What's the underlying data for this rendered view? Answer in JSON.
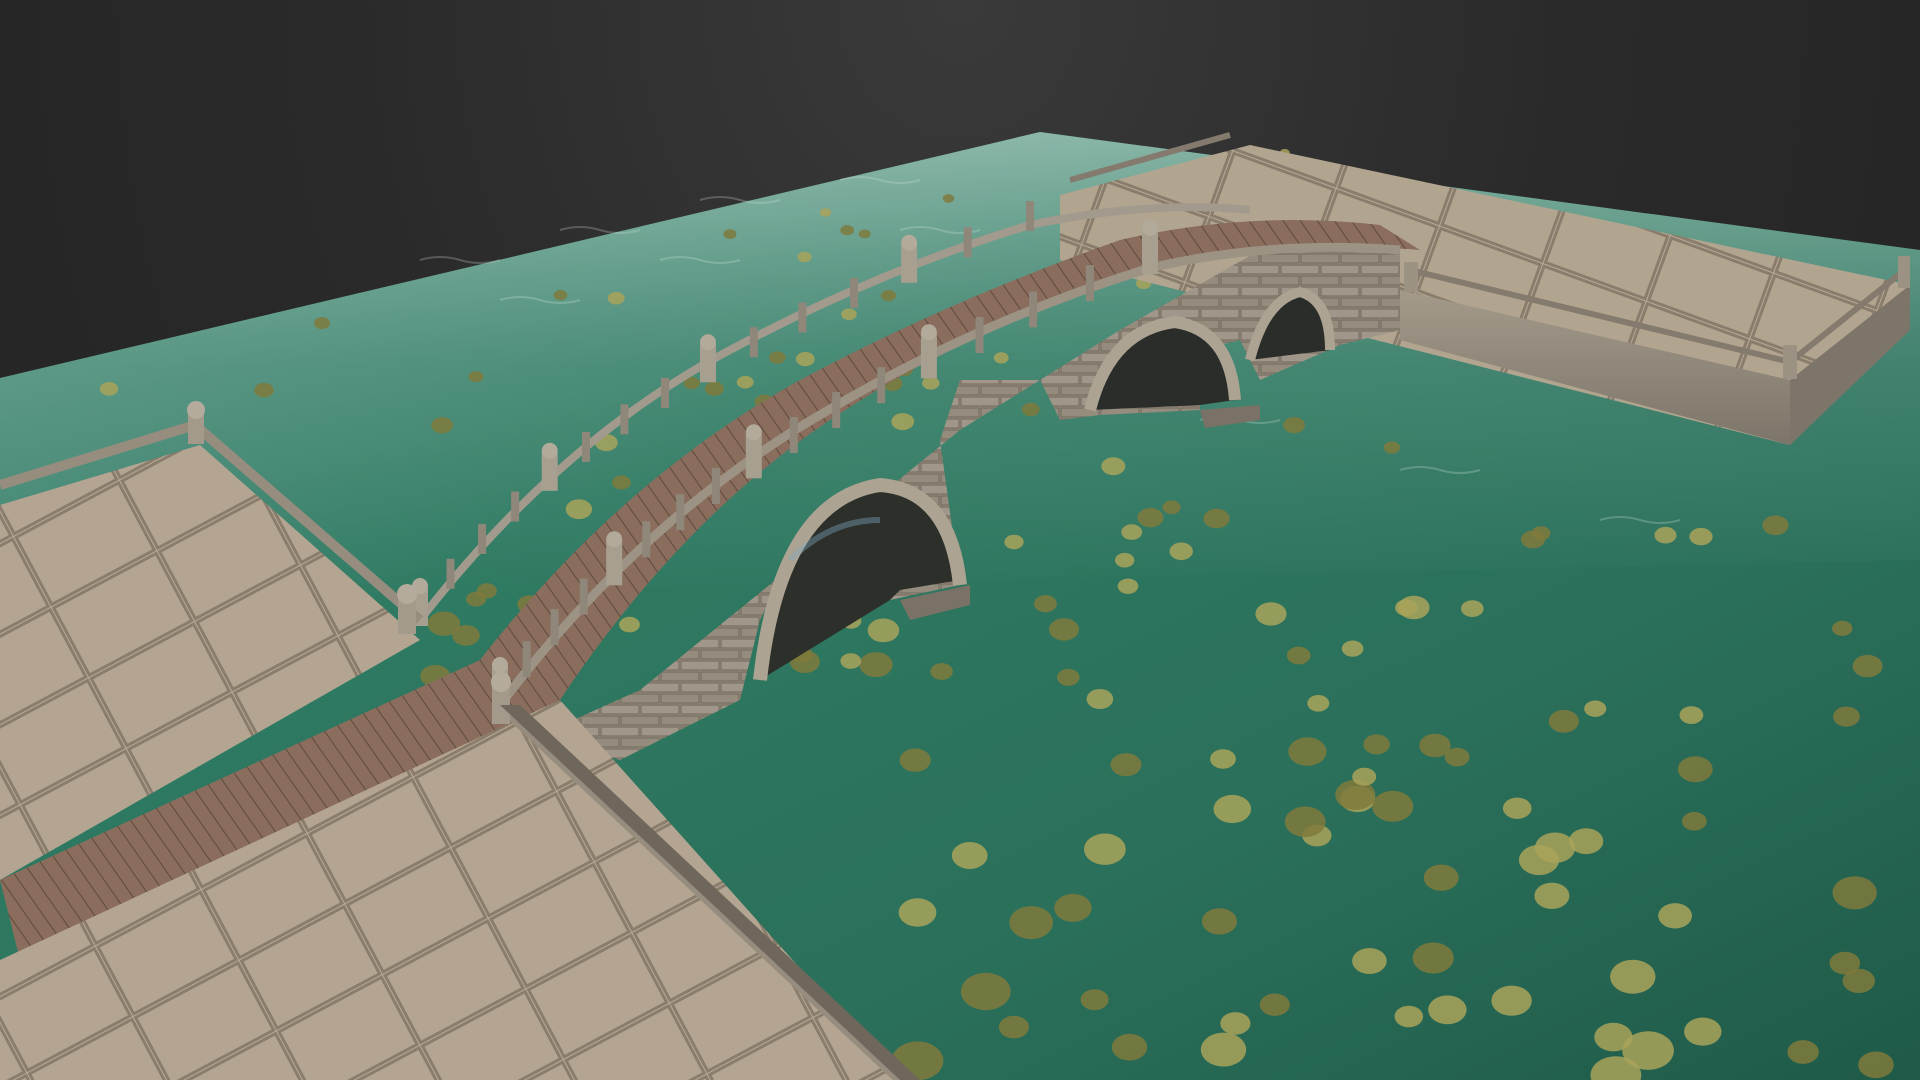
{
  "scene": {
    "subject": "stone-arch-bridge-3d-render",
    "colors": {
      "background": "#2b2b2b",
      "water_dark": "#1f5a48",
      "water_mid": "#2e7a62",
      "water_light": "#6fa89a",
      "lily_pad": "#a9a35a",
      "lily_pad_dark": "#7f7a3c",
      "paving": "#b5a795",
      "paving_dark": "#8a7d6c",
      "stone_wall": "#948b7d",
      "stone_wall_dark": "#6b6357",
      "deck_wood": "#8c6f5e",
      "deck_wood_dark": "#6a5244",
      "arch_shadow": "#2a2c28"
    },
    "bridge": {
      "arch_count": 3
    }
  }
}
